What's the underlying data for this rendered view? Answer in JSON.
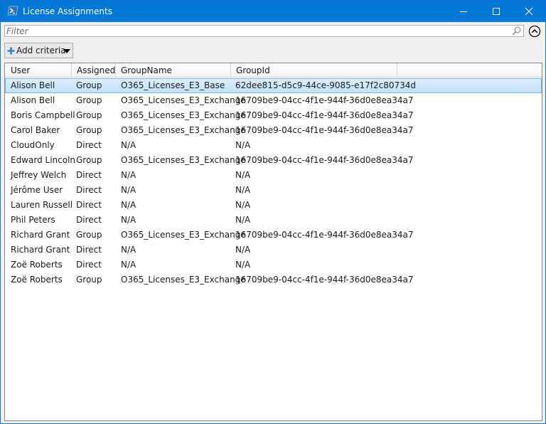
{
  "window": {
    "title": "License Assignments",
    "accent_color": "#0078d7",
    "icon": "powershell-icon"
  },
  "filter": {
    "placeholder": "Filter",
    "value": ""
  },
  "toolbar": {
    "add_criteria_label": "Add criteria"
  },
  "columns": [
    "User",
    "Assigned",
    "GroupName",
    "GroupId"
  ],
  "rows": [
    {
      "user": "Alison Bell",
      "assigned": "Group",
      "groupname": "O365_Licenses_E3_Base",
      "groupid": "62dee815-d5c9-44ce-9085-e17f2c80734d",
      "selected": true
    },
    {
      "user": "Alison Bell",
      "assigned": "Group",
      "groupname": "O365_Licenses_E3_Exchange",
      "groupid": "16709be9-04cc-4f1e-944f-36d0e8ea34a7"
    },
    {
      "user": "Boris Campbell",
      "assigned": "Group",
      "groupname": "O365_Licenses_E3_Exchange",
      "groupid": "16709be9-04cc-4f1e-944f-36d0e8ea34a7"
    },
    {
      "user": "Carol Baker",
      "assigned": "Group",
      "groupname": "O365_Licenses_E3_Exchange",
      "groupid": "16709be9-04cc-4f1e-944f-36d0e8ea34a7"
    },
    {
      "user": "CloudOnly",
      "assigned": "Direct",
      "groupname": "N/A",
      "groupid": "N/A"
    },
    {
      "user": "Edward Lincoln",
      "assigned": "Group",
      "groupname": "O365_Licenses_E3_Exchange",
      "groupid": "16709be9-04cc-4f1e-944f-36d0e8ea34a7"
    },
    {
      "user": "Jeffrey Welch",
      "assigned": "Direct",
      "groupname": "N/A",
      "groupid": "N/A"
    },
    {
      "user": "Jérôme User",
      "assigned": "Direct",
      "groupname": "N/A",
      "groupid": "N/A"
    },
    {
      "user": "Lauren Russell",
      "assigned": "Direct",
      "groupname": "N/A",
      "groupid": "N/A"
    },
    {
      "user": "Phil Peters",
      "assigned": "Direct",
      "groupname": "N/A",
      "groupid": "N/A"
    },
    {
      "user": "Richard Grant",
      "assigned": "Group",
      "groupname": "O365_Licenses_E3_Exchange",
      "groupid": "16709be9-04cc-4f1e-944f-36d0e8ea34a7"
    },
    {
      "user": "Richard Grant",
      "assigned": "Direct",
      "groupname": "N/A",
      "groupid": "N/A"
    },
    {
      "user": "Zoë Roberts",
      "assigned": "Direct",
      "groupname": "N/A",
      "groupid": "N/A"
    },
    {
      "user": "Zoë Roberts",
      "assigned": "Group",
      "groupname": "O365_Licenses_E3_Exchange",
      "groupid": "16709be9-04cc-4f1e-944f-36d0e8ea34a7"
    }
  ]
}
